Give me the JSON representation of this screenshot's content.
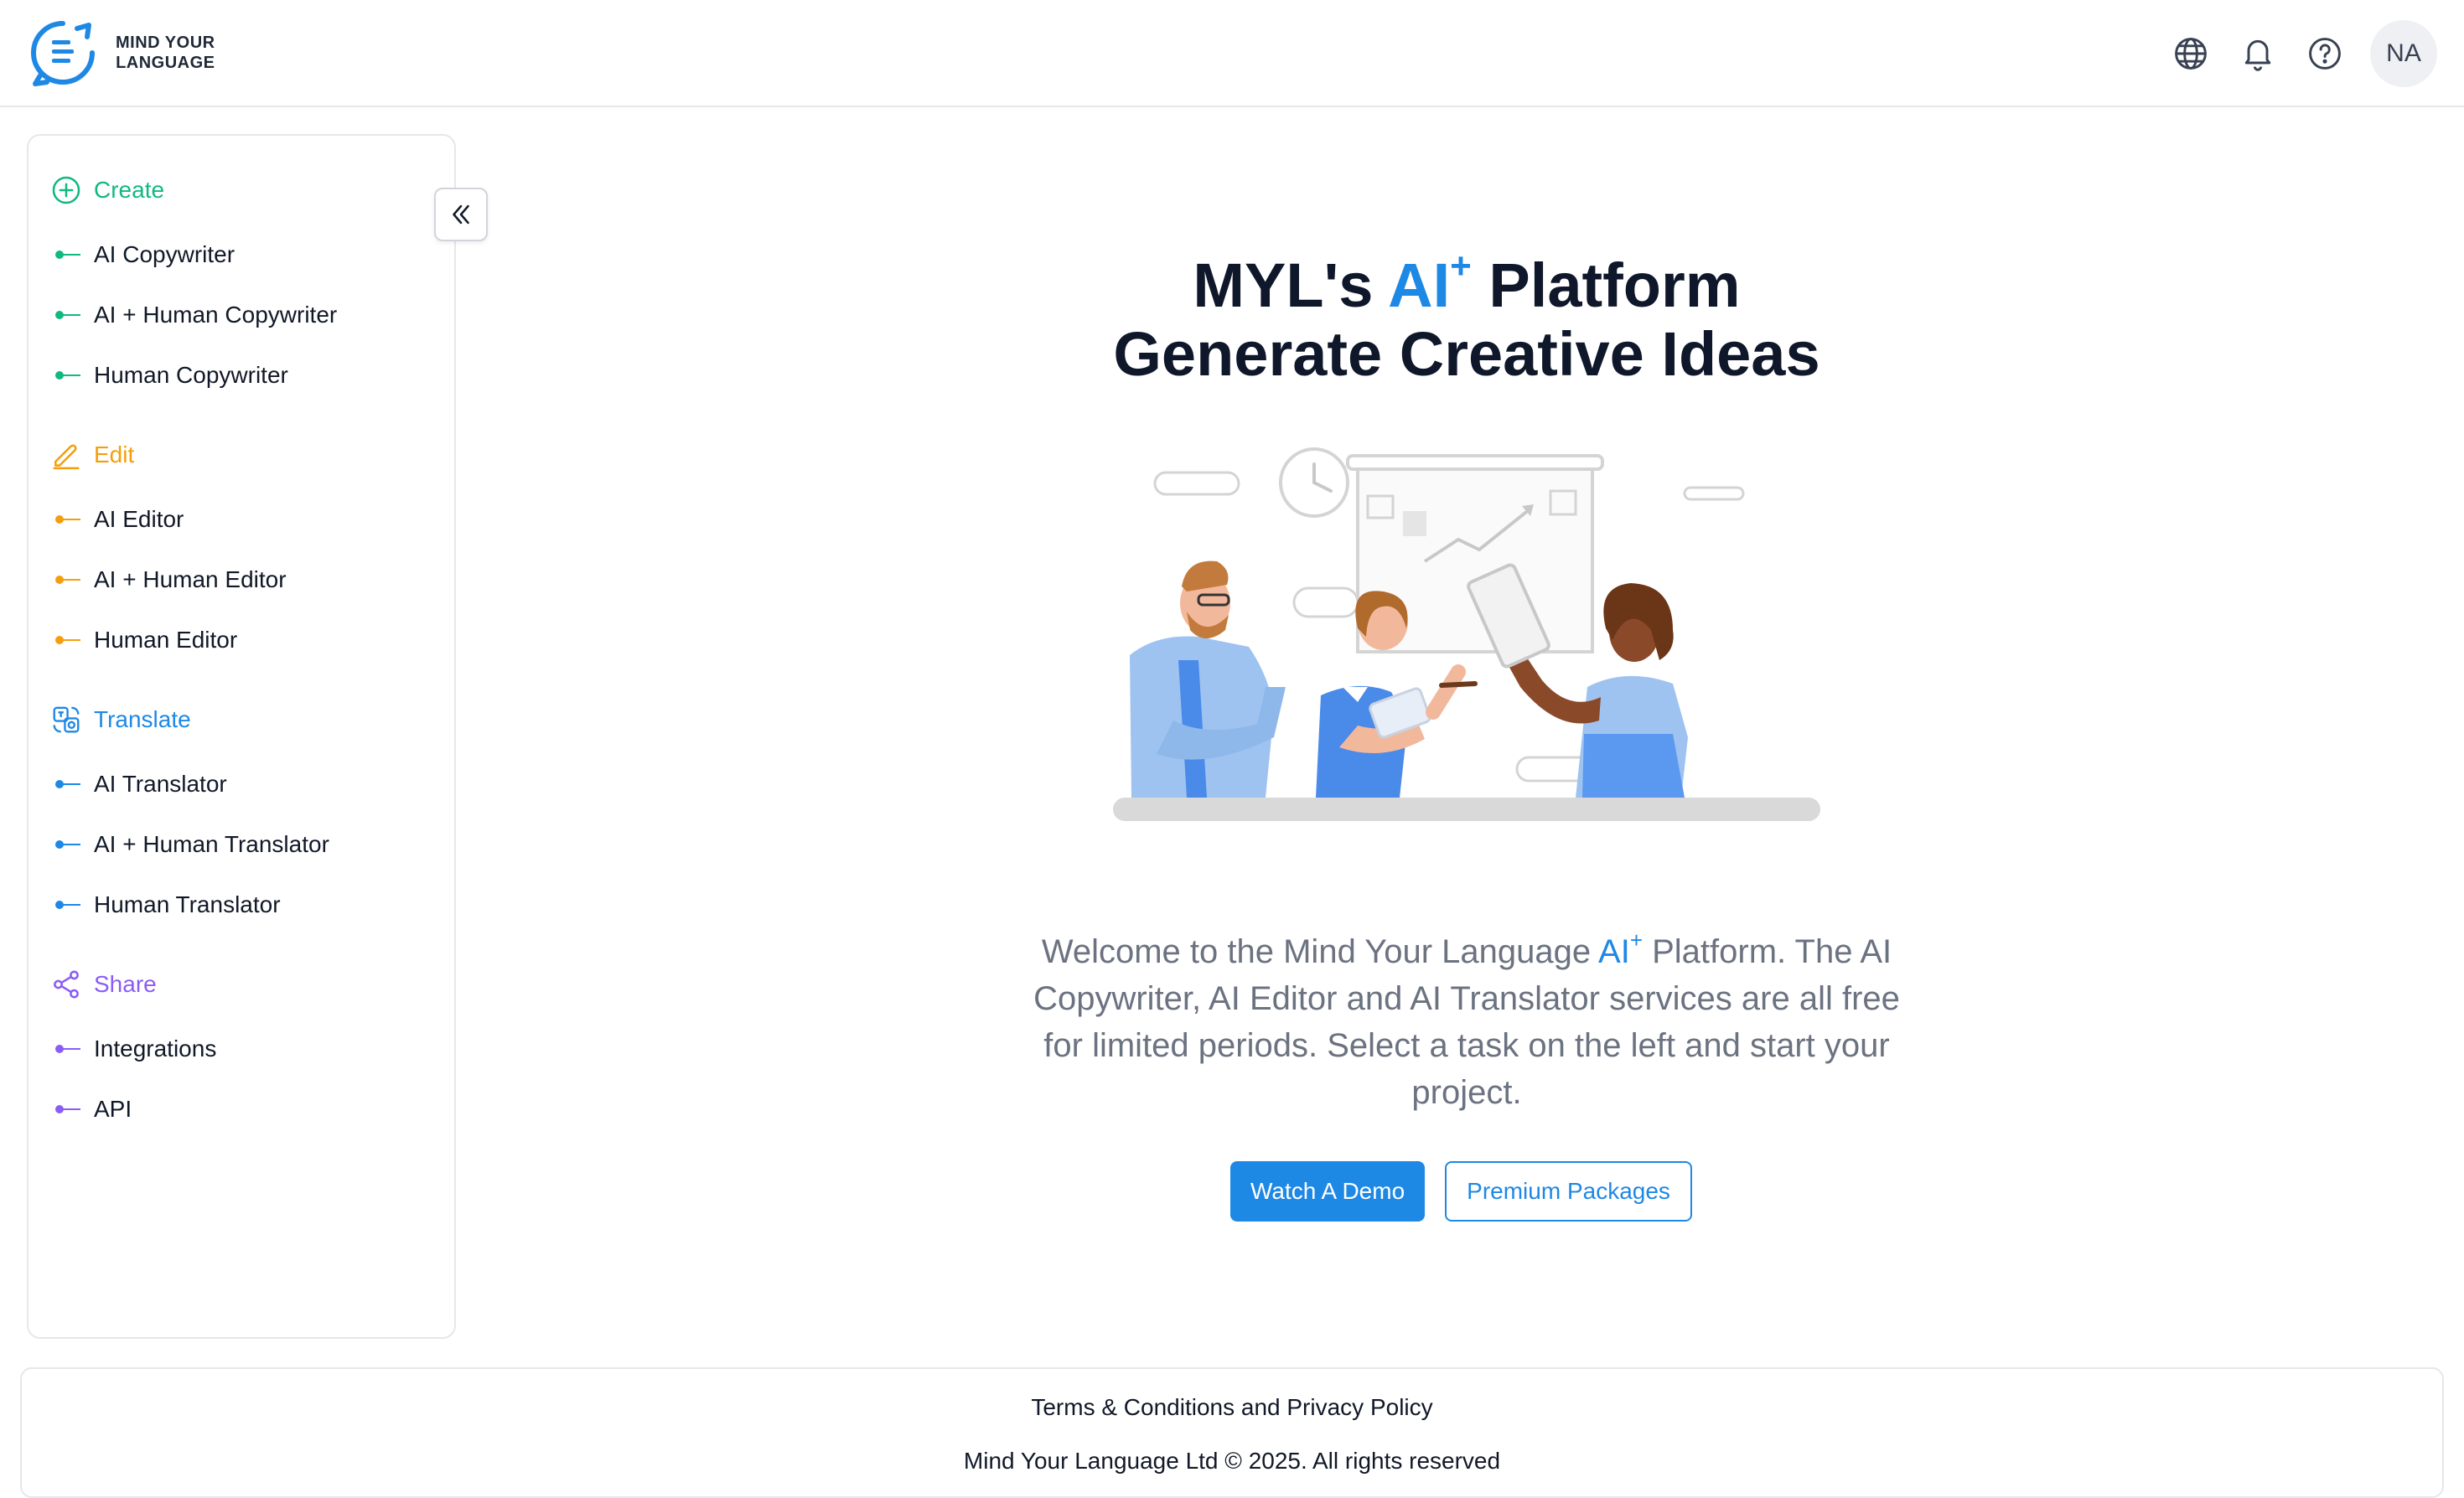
{
  "header": {
    "logo_line1": "MIND YOUR",
    "logo_line2": "LANGUAGE",
    "icons": [
      "globe-icon",
      "bell-icon",
      "help-icon"
    ],
    "avatar_initials": "NA"
  },
  "sidebar": {
    "sections": [
      {
        "title": "Create",
        "color": "#10b981",
        "icon": "plus-circle-icon",
        "items": [
          "AI Copywriter",
          "AI + Human Copywriter",
          "Human Copywriter"
        ]
      },
      {
        "title": "Edit",
        "color": "#f59e0b",
        "icon": "pencil-icon",
        "items": [
          "AI Editor",
          "AI + Human Editor",
          "Human Editor"
        ]
      },
      {
        "title": "Translate",
        "color": "#1e88e5",
        "icon": "translate-icon",
        "items": [
          "AI Translator",
          "AI + Human Translator",
          "Human Translator"
        ]
      },
      {
        "title": "Share",
        "color": "#8b5cf6",
        "icon": "share-icon",
        "items": [
          "Integrations",
          "API"
        ]
      }
    ],
    "collapse_icon": "double-chevron-left-icon"
  },
  "main": {
    "title_prefix": "MYL's ",
    "title_ai": "AI",
    "title_plus": "+",
    "title_suffix": " Platform",
    "subtitle": "Generate Creative Ideas",
    "welcome_prefix": "Welcome to the Mind Your Language ",
    "welcome_ai": "AI",
    "welcome_plus": "+",
    "welcome_suffix": " Platform. The AI Copywriter, AI Editor and AI Translator services are all free for limited periods. Select a task on the left and start your project.",
    "demo_button": "Watch A Demo",
    "premium_button": "Premium Packages"
  },
  "footer": {
    "terms_link": "Terms & Conditions and Privacy Policy",
    "copyright": "Mind Your Language Ltd © 2025. All rights reserved"
  },
  "colors": {
    "accent": "#1e88e5",
    "create": "#10b981",
    "edit": "#f59e0b",
    "share": "#8b5cf6"
  }
}
